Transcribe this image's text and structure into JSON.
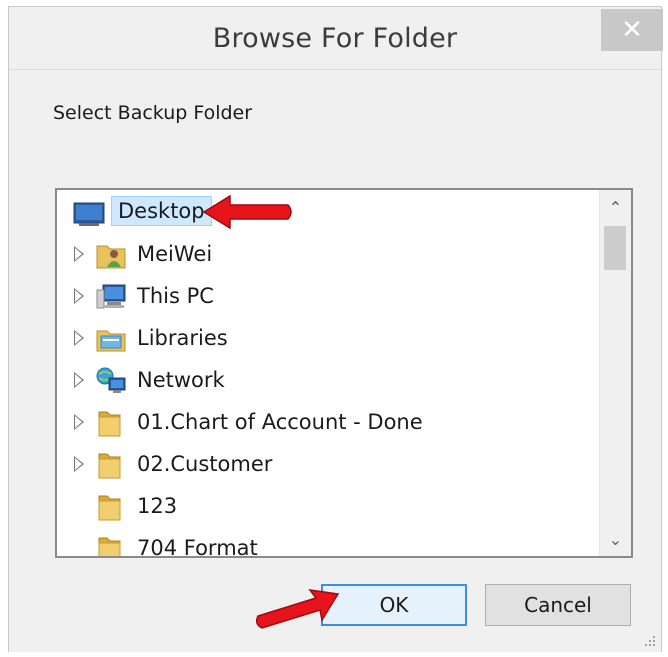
{
  "window": {
    "title": "Browse For Folder",
    "close_glyph": "✕"
  },
  "prompt": "Select Backup Folder",
  "tree": {
    "items": [
      {
        "label": "Desktop",
        "icon": "desktop-icon",
        "expandable": false,
        "selected": true
      },
      {
        "label": "MeiWei",
        "icon": "user-folder-icon",
        "expandable": true
      },
      {
        "label": "This PC",
        "icon": "computer-icon",
        "expandable": true
      },
      {
        "label": "Libraries",
        "icon": "libraries-icon",
        "expandable": true
      },
      {
        "label": "Network",
        "icon": "network-icon",
        "expandable": true
      },
      {
        "label": "01.Chart of Account - Done",
        "icon": "folder-icon",
        "expandable": true
      },
      {
        "label": "02.Customer",
        "icon": "folder-icon",
        "expandable": true
      },
      {
        "label": "123",
        "icon": "folder-icon",
        "expandable": false
      },
      {
        "label": "704 Format",
        "icon": "folder-icon",
        "expandable": false
      }
    ]
  },
  "buttons": {
    "ok": "OK",
    "cancel": "Cancel"
  },
  "colors": {
    "selection_bg": "#cde8ff",
    "selection_border": "#99d1ff",
    "arrow_red": "#e8141c",
    "ok_border": "#3c8fe0"
  }
}
